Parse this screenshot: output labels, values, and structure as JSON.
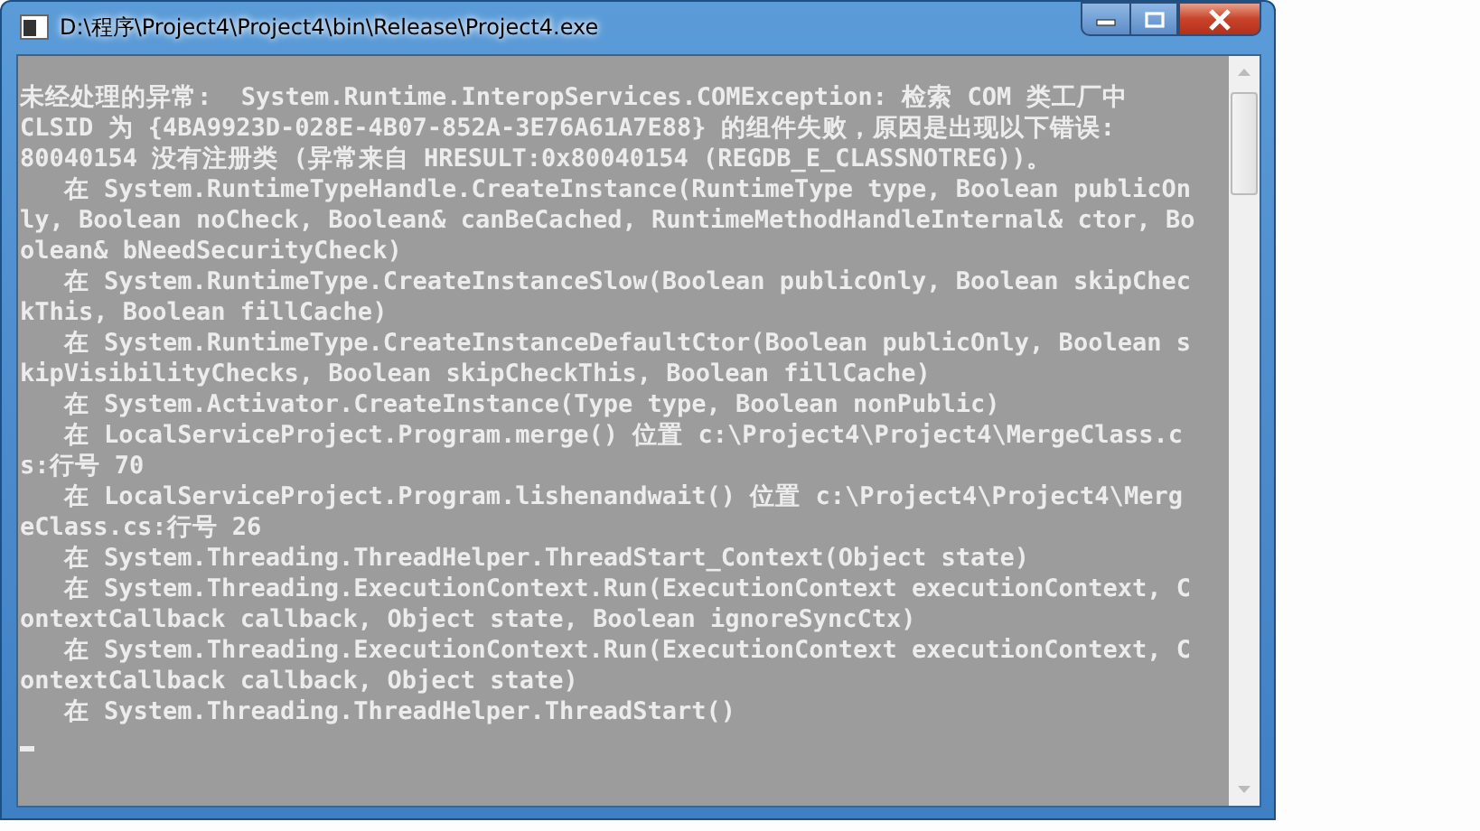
{
  "window": {
    "title": "D:\\程序\\Project4\\Project4\\bin\\Release\\Project4.exe"
  },
  "console": {
    "lines": [
      "未经处理的异常:  System.Runtime.InteropServices.COMException: 检索 COM 类工厂中",
      "CLSID 为 {4BA9923D-028E-4B07-852A-3E76A61A7E88} 的组件失败，原因是出现以下错误:",
      "80040154 没有注册类 (异常来自 HRESULT:0x80040154 (REGDB_E_CLASSNOTREG))。",
      "   在 System.RuntimeTypeHandle.CreateInstance(RuntimeType type, Boolean publicOn",
      "ly, Boolean noCheck, Boolean& canBeCached, RuntimeMethodHandleInternal& ctor, Bo",
      "olean& bNeedSecurityCheck)",
      "   在 System.RuntimeType.CreateInstanceSlow(Boolean publicOnly, Boolean skipChec",
      "kThis, Boolean fillCache)",
      "   在 System.RuntimeType.CreateInstanceDefaultCtor(Boolean publicOnly, Boolean s",
      "kipVisibilityChecks, Boolean skipCheckThis, Boolean fillCache)",
      "   在 System.Activator.CreateInstance(Type type, Boolean nonPublic)",
      "   在 LocalServiceProject.Program.merge() 位置 c:\\Project4\\Project4\\MergeClass.c",
      "s:行号 70",
      "   在 LocalServiceProject.Program.lishenandwait() 位置 c:\\Project4\\Project4\\Merg",
      "eClass.cs:行号 26",
      "   在 System.Threading.ThreadHelper.ThreadStart_Context(Object state)",
      "   在 System.Threading.ExecutionContext.Run(ExecutionContext executionContext, C",
      "ontextCallback callback, Object state, Boolean ignoreSyncCtx)",
      "   在 System.Threading.ExecutionContext.Run(ExecutionContext executionContext, C",
      "ontextCallback callback, Object state)",
      "   在 System.Threading.ThreadHelper.ThreadStart()"
    ]
  }
}
